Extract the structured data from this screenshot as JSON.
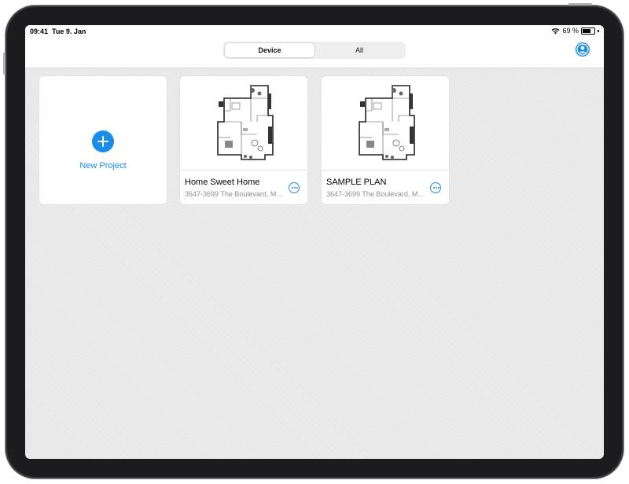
{
  "statusbar": {
    "time": "09:41",
    "date": "Tue 9. Jan",
    "battery": "69 %",
    "battery_level": 0.69,
    "icons": [
      "wifi-icon",
      "battery-icon"
    ]
  },
  "navbar": {
    "segments": [
      {
        "label": "Device",
        "selected": true
      },
      {
        "label": "All",
        "selected": false
      }
    ],
    "profile_icon": "person-icon"
  },
  "new_project": {
    "label": "New Project",
    "icon": "plus-icon"
  },
  "projects": [
    {
      "title": "Home Sweet Home",
      "address": "3647-3699 The Boulevard, Mo...",
      "more_icon": "ellipsis-icon"
    },
    {
      "title": "SAMPLE PLAN",
      "address": "3647-3699 The Boulevard, Mo...",
      "more_icon": "ellipsis-icon"
    }
  ],
  "colors": {
    "accent": "#1a8ee6",
    "background": "#e9e9e9",
    "card": "#ffffff",
    "subtitle": "#8e8e93"
  }
}
